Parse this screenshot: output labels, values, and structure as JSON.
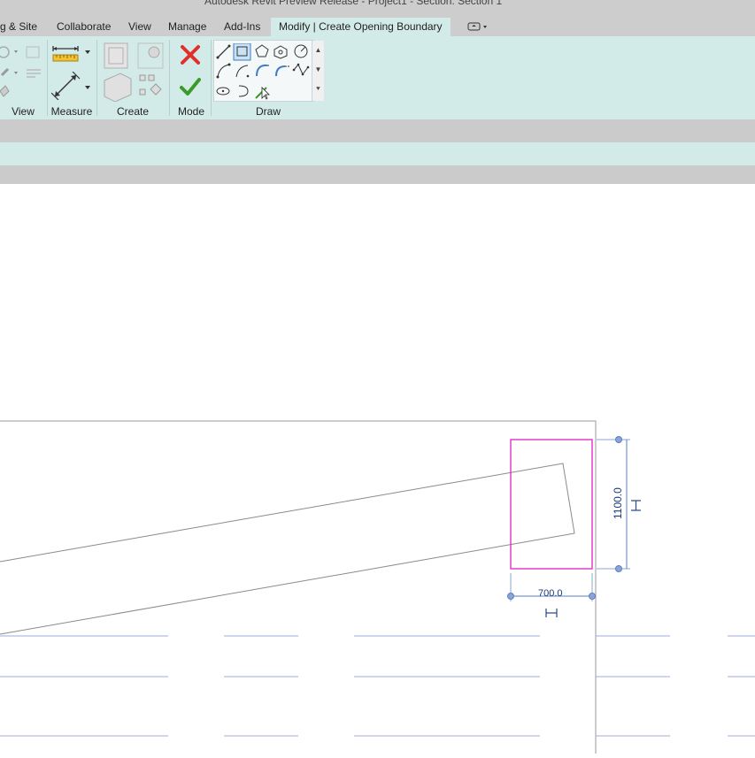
{
  "window": {
    "title": "Autodesk Revit Preview Release - Project1 - Section: Section 1"
  },
  "tabs": [
    {
      "label": "g & Site",
      "active": false
    },
    {
      "label": "Collaborate",
      "active": false
    },
    {
      "label": "View",
      "active": false
    },
    {
      "label": "Manage",
      "active": false
    },
    {
      "label": "Add-Ins",
      "active": false
    },
    {
      "label": "Modify | Create Opening Boundary",
      "active": true
    }
  ],
  "ribbon": {
    "panels": {
      "view": "View",
      "measure": "Measure",
      "create": "Create",
      "mode": "Mode",
      "draw": "Draw"
    }
  },
  "canvas": {
    "dimension_width": "700.0",
    "dimension_height": "1100.0"
  },
  "colors": {
    "ribbon_bg": "#d3ebe8",
    "opening_boundary": "#e020c0",
    "dimension": "#5a7fc4",
    "finish_green": "#3a9a2a",
    "cancel_red": "#e0302a"
  }
}
